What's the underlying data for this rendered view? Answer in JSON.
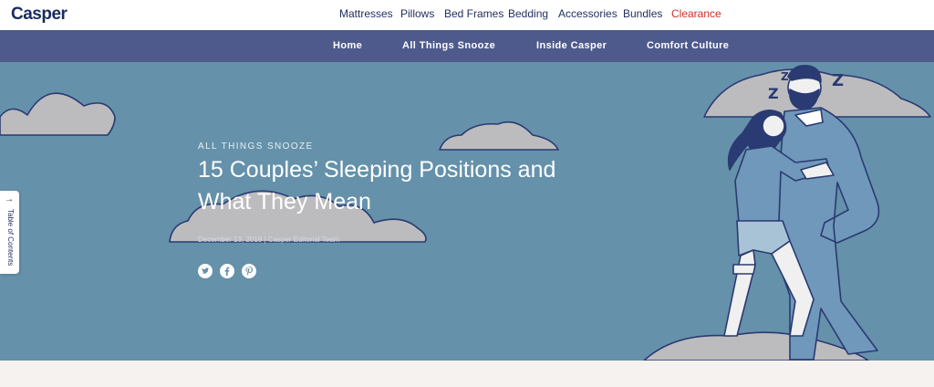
{
  "brand": {
    "logo": "Casper"
  },
  "top_menu": [
    {
      "label": "Mattresses",
      "color": "#1f2d5c"
    },
    {
      "label": "Pillows",
      "color": "#1f2d5c"
    },
    {
      "label": "Bed Frames",
      "color": "#1f2d5c"
    },
    {
      "label": "Bedding",
      "color": "#1f2d5c"
    },
    {
      "label": "Accessories",
      "color": "#1f2d5c"
    },
    {
      "label": "Bundles",
      "color": "#1f2d5c"
    },
    {
      "label": "Clearance",
      "color": "#c8302b"
    }
  ],
  "sub_menu": [
    {
      "label": "Home"
    },
    {
      "label": "All Things Snooze"
    },
    {
      "label": "Inside Casper"
    },
    {
      "label": "Comfort Culture"
    }
  ],
  "hero": {
    "eyebrow": "ALL THINGS SNOOZE",
    "title": "15 Couples’ Sleeping Positions and What They Mean",
    "byline": "December 13, 2019 | Casper Editorial Team",
    "share_icons": [
      "twitter-icon",
      "facebook-icon",
      "pinterest-icon"
    ],
    "background_color": "#6591aa"
  },
  "toc": {
    "arrow": "→",
    "label": "Table of Contents"
  },
  "colors": {
    "nav_bar": "#4d5a8b",
    "accent_red": "#c8302b",
    "navy": "#1f2d5c"
  }
}
